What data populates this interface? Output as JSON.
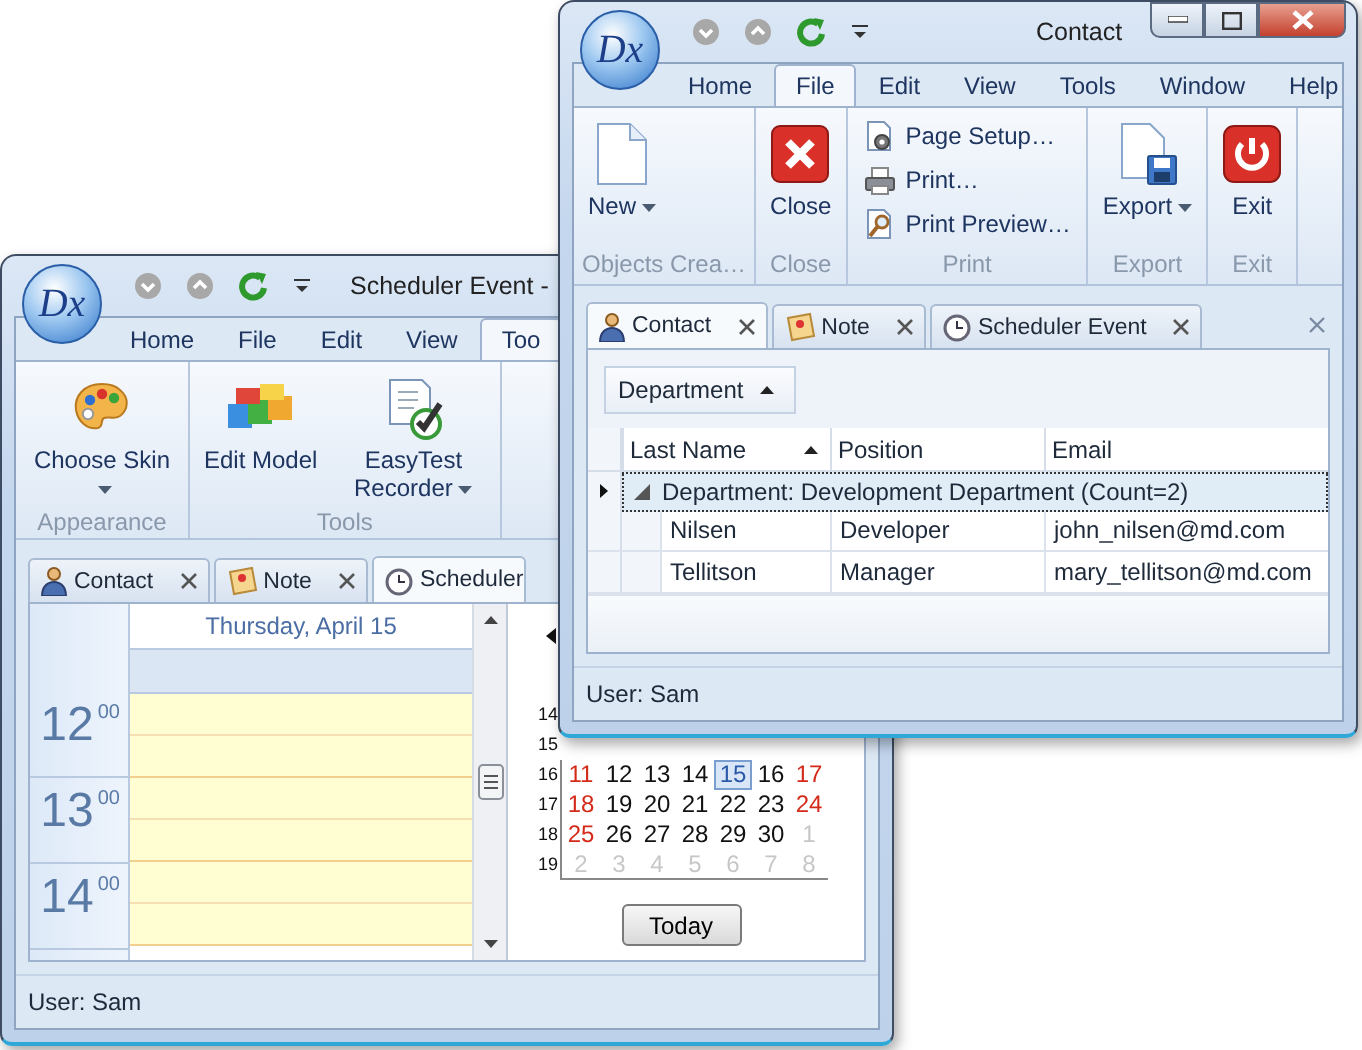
{
  "scheduler_window": {
    "app_button": "Dx",
    "title": "Scheduler Event -",
    "ribbon_tabs": [
      {
        "label": "Home",
        "selected": false
      },
      {
        "label": "File",
        "selected": false
      },
      {
        "label": "Edit",
        "selected": false
      },
      {
        "label": "View",
        "selected": false
      },
      {
        "label": "Too",
        "selected": true
      }
    ],
    "ribbon_groups": [
      {
        "label": "Appearance",
        "buttons": [
          {
            "label": "Choose Skin",
            "kind": "large",
            "dropdown": true
          }
        ]
      },
      {
        "label": "Tools",
        "buttons": [
          {
            "label": "Edit Model",
            "kind": "large",
            "dropdown": false
          },
          {
            "label": "EasyTest Recorder",
            "kind": "large",
            "dropdown": true
          }
        ]
      }
    ],
    "doc_tabs": [
      {
        "label": "Contact",
        "selected": false
      },
      {
        "label": "Note",
        "selected": false
      },
      {
        "label": "Scheduler",
        "selected": true
      }
    ],
    "day_header": "Thursday, April 15",
    "time_slots": [
      {
        "hour": "12",
        "minutes": "00"
      },
      {
        "hour": "13",
        "minutes": "00"
      },
      {
        "hour": "14",
        "minutes": "00"
      }
    ],
    "calendar": {
      "weeks": [
        {
          "number": "14"
        },
        {
          "number": "15"
        },
        {
          "number": "16",
          "days": [
            {
              "day": "11",
              "kind": "weekend",
              "selected": false
            },
            {
              "day": "12",
              "kind": "weekday",
              "selected": false
            },
            {
              "day": "13",
              "kind": "weekday",
              "selected": false
            },
            {
              "day": "14",
              "kind": "weekday",
              "selected": false
            },
            {
              "day": "15",
              "kind": "weekday",
              "selected": true
            },
            {
              "day": "16",
              "kind": "weekday",
              "selected": false
            },
            {
              "day": "17",
              "kind": "weekend",
              "selected": false
            }
          ]
        },
        {
          "number": "17",
          "days": [
            {
              "day": "18",
              "kind": "weekend",
              "selected": false
            },
            {
              "day": "19",
              "kind": "weekday",
              "selected": false
            },
            {
              "day": "20",
              "kind": "weekday",
              "selected": false
            },
            {
              "day": "21",
              "kind": "weekday",
              "selected": false
            },
            {
              "day": "22",
              "kind": "weekday",
              "selected": false
            },
            {
              "day": "23",
              "kind": "weekday",
              "selected": false
            },
            {
              "day": "24",
              "kind": "weekend",
              "selected": false
            }
          ]
        },
        {
          "number": "18",
          "days": [
            {
              "day": "25",
              "kind": "weekend",
              "selected": false
            },
            {
              "day": "26",
              "kind": "weekday",
              "selected": false
            },
            {
              "day": "27",
              "kind": "weekday",
              "selected": false
            },
            {
              "day": "28",
              "kind": "weekday",
              "selected": false
            },
            {
              "day": "29",
              "kind": "weekday",
              "selected": false
            },
            {
              "day": "30",
              "kind": "weekday",
              "selected": false
            },
            {
              "day": "1",
              "kind": "adjacent",
              "selected": false
            }
          ]
        },
        {
          "number": "19",
          "days": [
            {
              "day": "2",
              "kind": "adjacent",
              "selected": false
            },
            {
              "day": "3",
              "kind": "adjacent",
              "selected": false
            },
            {
              "day": "4",
              "kind": "adjacent",
              "selected": false
            },
            {
              "day": "5",
              "kind": "adjacent",
              "selected": false
            },
            {
              "day": "6",
              "kind": "adjacent",
              "selected": false
            },
            {
              "day": "7",
              "kind": "adjacent",
              "selected": false
            },
            {
              "day": "8",
              "kind": "adjacent",
              "selected": false
            }
          ]
        }
      ]
    },
    "today_button": "Today",
    "status": "User: Sam"
  },
  "contact_window": {
    "app_button": "Dx",
    "title": "Contact",
    "ribbon_tabs": [
      {
        "label": "Home",
        "selected": false
      },
      {
        "label": "File",
        "selected": true
      },
      {
        "label": "Edit",
        "selected": false
      },
      {
        "label": "View",
        "selected": false
      },
      {
        "label": "Tools",
        "selected": false
      },
      {
        "label": "Window",
        "selected": false
      },
      {
        "label": "Help",
        "selected": false
      }
    ],
    "ribbon_groups": [
      {
        "label": "Objects Crea…",
        "buttons": [
          {
            "label": "New",
            "kind": "large",
            "dropdown": true
          }
        ]
      },
      {
        "label": "Close",
        "buttons": [
          {
            "label": "Close",
            "kind": "large",
            "dropdown": false
          }
        ]
      },
      {
        "label": "Print",
        "buttons": [
          {
            "label": "Page Setup…",
            "kind": "small",
            "dropdown": false
          },
          {
            "label": "Print…",
            "kind": "small",
            "dropdown": false
          },
          {
            "label": "Print Preview…",
            "kind": "small",
            "dropdown": false
          }
        ]
      },
      {
        "label": "Export",
        "buttons": [
          {
            "label": "Export",
            "kind": "large",
            "dropdown": true
          }
        ]
      },
      {
        "label": "Exit",
        "buttons": [
          {
            "label": "Exit",
            "kind": "large",
            "dropdown": false
          }
        ]
      }
    ],
    "doc_tabs": [
      {
        "label": "Contact",
        "selected": true
      },
      {
        "label": "Note",
        "selected": false
      },
      {
        "label": "Scheduler Event",
        "selected": false
      }
    ],
    "grid": {
      "group_panel": [
        {
          "label": "Department",
          "sort_ascending": true
        }
      ],
      "columns": [
        {
          "label": "Last Name",
          "sort_ascending": true
        },
        {
          "label": "Position"
        },
        {
          "label": "Email"
        }
      ],
      "groups": [
        {
          "label": "Department: Development Department (Count=2)",
          "expanded": true,
          "focused": true,
          "rows": [
            {
              "cells": [
                "Nilsen",
                "Developer",
                "john_nilsen@md.com"
              ]
            },
            {
              "cells": [
                "Tellitson",
                "Manager",
                "mary_tellitson@md.com"
              ]
            }
          ]
        }
      ]
    },
    "status": "User: Sam"
  }
}
